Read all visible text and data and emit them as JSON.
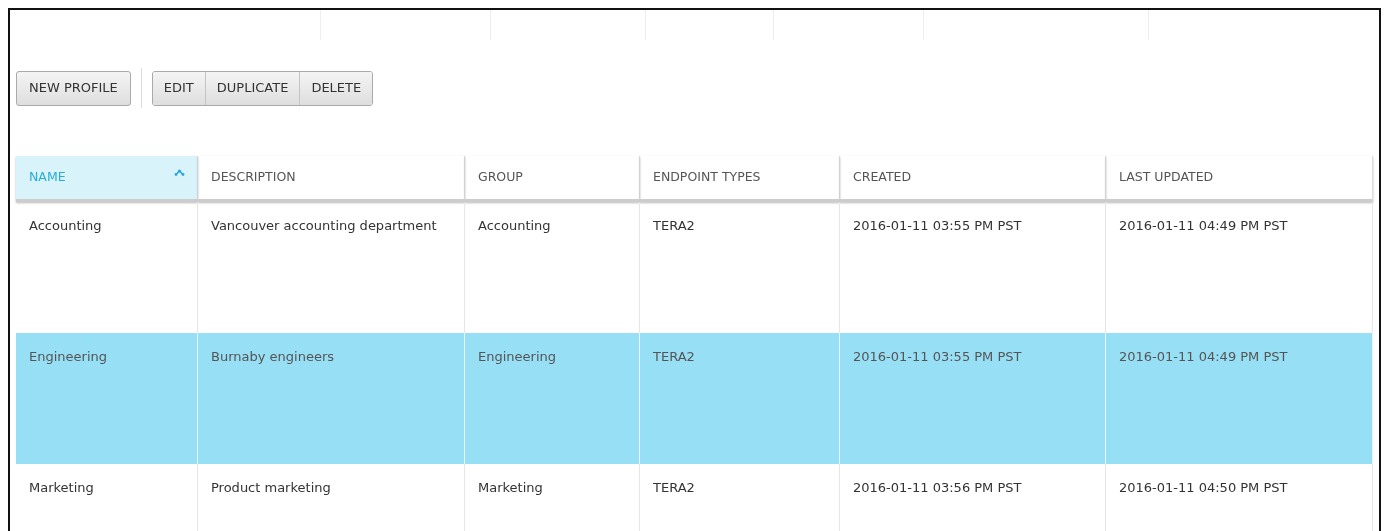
{
  "toolbar": {
    "primary_button": "NEW PROFILE",
    "button_group": [
      "EDIT",
      "DUPLICATE",
      "DELETE"
    ]
  },
  "table": {
    "columns": [
      {
        "label": "NAME",
        "sorted": true
      },
      {
        "label": "DESCRIPTION",
        "sorted": false
      },
      {
        "label": "GROUP",
        "sorted": false
      },
      {
        "label": "ENDPOINT TYPES",
        "sorted": false
      },
      {
        "label": "CREATED",
        "sorted": false
      },
      {
        "label": "LAST UPDATED",
        "sorted": false
      }
    ],
    "rows": [
      {
        "selected": false,
        "cells": [
          "Accounting",
          "Vancouver accounting department",
          "Accounting",
          "TERA2",
          "2016-01-11 03:55 PM PST",
          "2016-01-11 04:49 PM PST"
        ]
      },
      {
        "selected": true,
        "cells": [
          "Engineering",
          "Burnaby engineers",
          "Engineering",
          "TERA2",
          "2016-01-11 03:55 PM PST",
          "2016-01-11 04:49 PM PST"
        ]
      },
      {
        "selected": false,
        "cells": [
          "Marketing",
          "Product marketing",
          "Marketing",
          "TERA2",
          "2016-01-11 03:56 PM PST",
          "2016-01-11 04:50 PM PST"
        ]
      }
    ]
  }
}
